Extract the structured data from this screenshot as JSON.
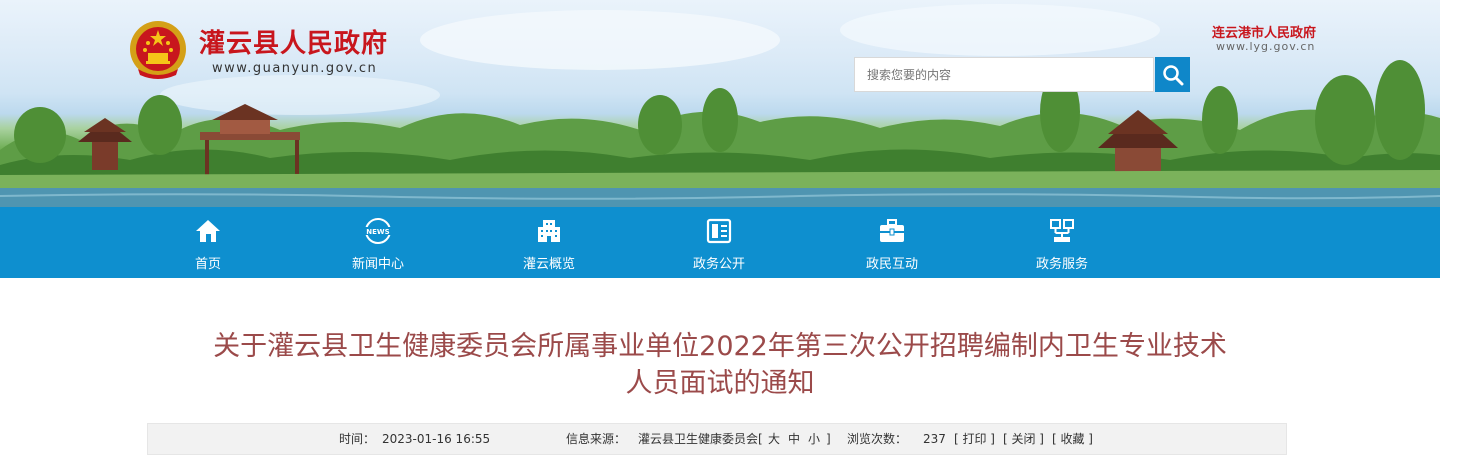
{
  "header": {
    "site_name": "灌云县人民政府",
    "site_url": "www.guanyun.gov.cn",
    "parent_site_name": "连云港市人民政府",
    "parent_site_url": "www.lyg.gov.cn",
    "emblem_icon": "national-emblem-icon"
  },
  "search": {
    "placeholder": "搜索您要的内容",
    "button_icon": "search-icon"
  },
  "nav": {
    "items": [
      {
        "label": "首页",
        "icon": "home-icon"
      },
      {
        "label": "新闻中心",
        "icon": "news-icon"
      },
      {
        "label": "灌云概览",
        "icon": "building-icon"
      },
      {
        "label": "政务公开",
        "icon": "open-book-icon"
      },
      {
        "label": "政民互动",
        "icon": "briefcase-icon"
      },
      {
        "label": "政务服务",
        "icon": "network-icon"
      }
    ]
  },
  "article": {
    "title_line1": "关于灌云县卫生健康委员会所属事业单位2022年第三次公开招聘编制内卫生专业技术",
    "title_line2": "人员面试的通知",
    "time_label": "时间：",
    "time_value": "2023-01-16 16:55",
    "source_label": "信息来源：",
    "source_value": "灌云县卫生健康委员会",
    "font_bracket_open": "[",
    "font_large": "大",
    "font_medium": "中",
    "font_small": "小",
    "font_bracket_close": "]",
    "views_label": "浏览次数：",
    "views_value": "237",
    "print_label": "[ 打印 ]",
    "close_label": "[ 关闭 ]",
    "favorite_label": "[ 收藏 ]"
  },
  "colors": {
    "nav_bg": "#0e8fcf",
    "brand_red": "#c8161d",
    "title_color": "#9b4a4a",
    "search_button": "#0f87c9"
  }
}
